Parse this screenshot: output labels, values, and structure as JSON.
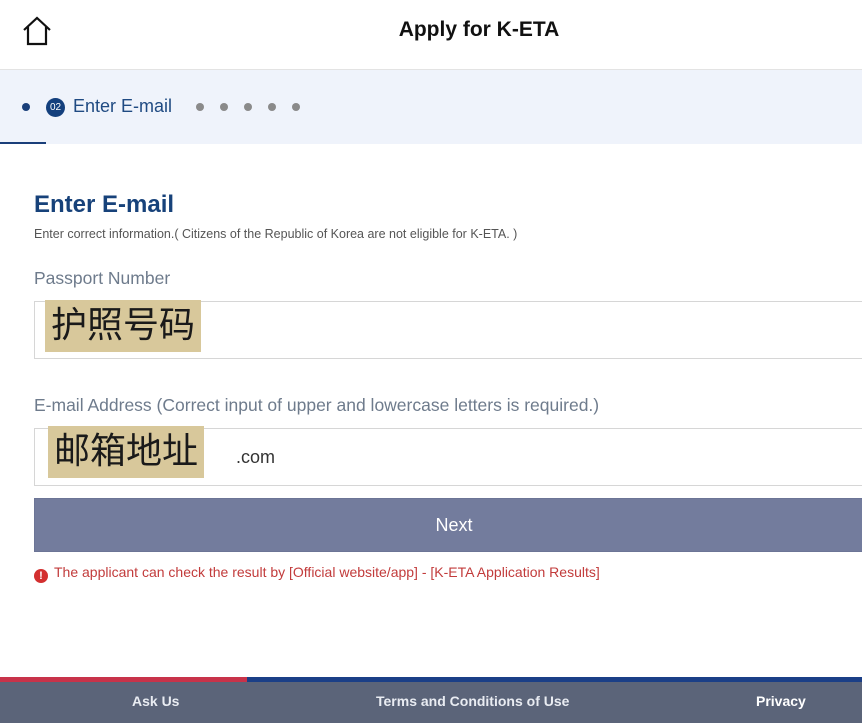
{
  "header": {
    "title": "Apply for K-ETA",
    "home_icon": "home-icon"
  },
  "steps": {
    "current_number": "02",
    "current_label": "Enter E-mail",
    "total_dots_after": 5
  },
  "form": {
    "heading": "Enter E-mail",
    "subtitle": "Enter correct information.( Citizens of the Republic of Korea are not eligible for K-ETA. )",
    "passport": {
      "label": "Passport Number",
      "redacted_text": "护照号码"
    },
    "email": {
      "label": "E-mail Address (Correct input of upper and lowercase letters is required.)",
      "redacted_text": "邮箱地址",
      "suffix": ".com"
    },
    "next_label": "Next",
    "notice": "The applicant can check the result by [Official website/app] - [K-ETA Application Results]",
    "notice_icon": "!"
  },
  "footer": {
    "ask_us": "Ask Us",
    "terms": "Terms and Conditions of Use",
    "privacy": "Privacy"
  },
  "colors": {
    "primary": "#17427a",
    "step_bg": "#eff3fb",
    "button": "#737c9d",
    "redaction": "#d8c89b",
    "notice": "#c23b3b",
    "footer": "#5b6479",
    "footer_red": "#c8334a",
    "footer_blue": "#1b3f87"
  }
}
